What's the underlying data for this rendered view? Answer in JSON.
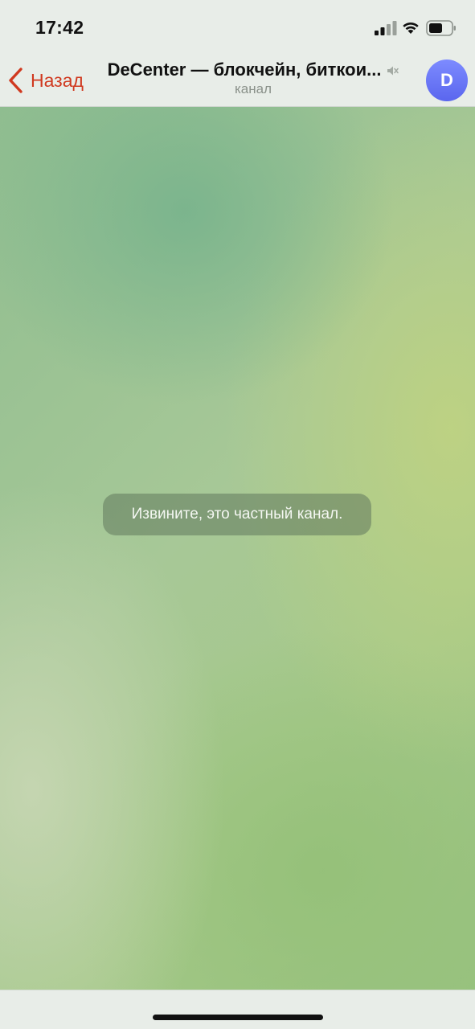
{
  "status_bar": {
    "time": "17:42",
    "icons": [
      "signal-icon",
      "wifi-icon",
      "battery-icon"
    ]
  },
  "nav": {
    "back_label": "Назад",
    "title": "DeCenter — блокчейн, биткои...",
    "subtitle": "канал",
    "avatar_letter": "D",
    "back_icon": "chevron-left-icon",
    "mute_icon": "muted-speaker-icon"
  },
  "chat": {
    "notice": "Извините, это частный канал."
  },
  "colors": {
    "accent": "#d0391f",
    "avatar": "#6b77f5",
    "bar_background": "#e8ede8"
  }
}
